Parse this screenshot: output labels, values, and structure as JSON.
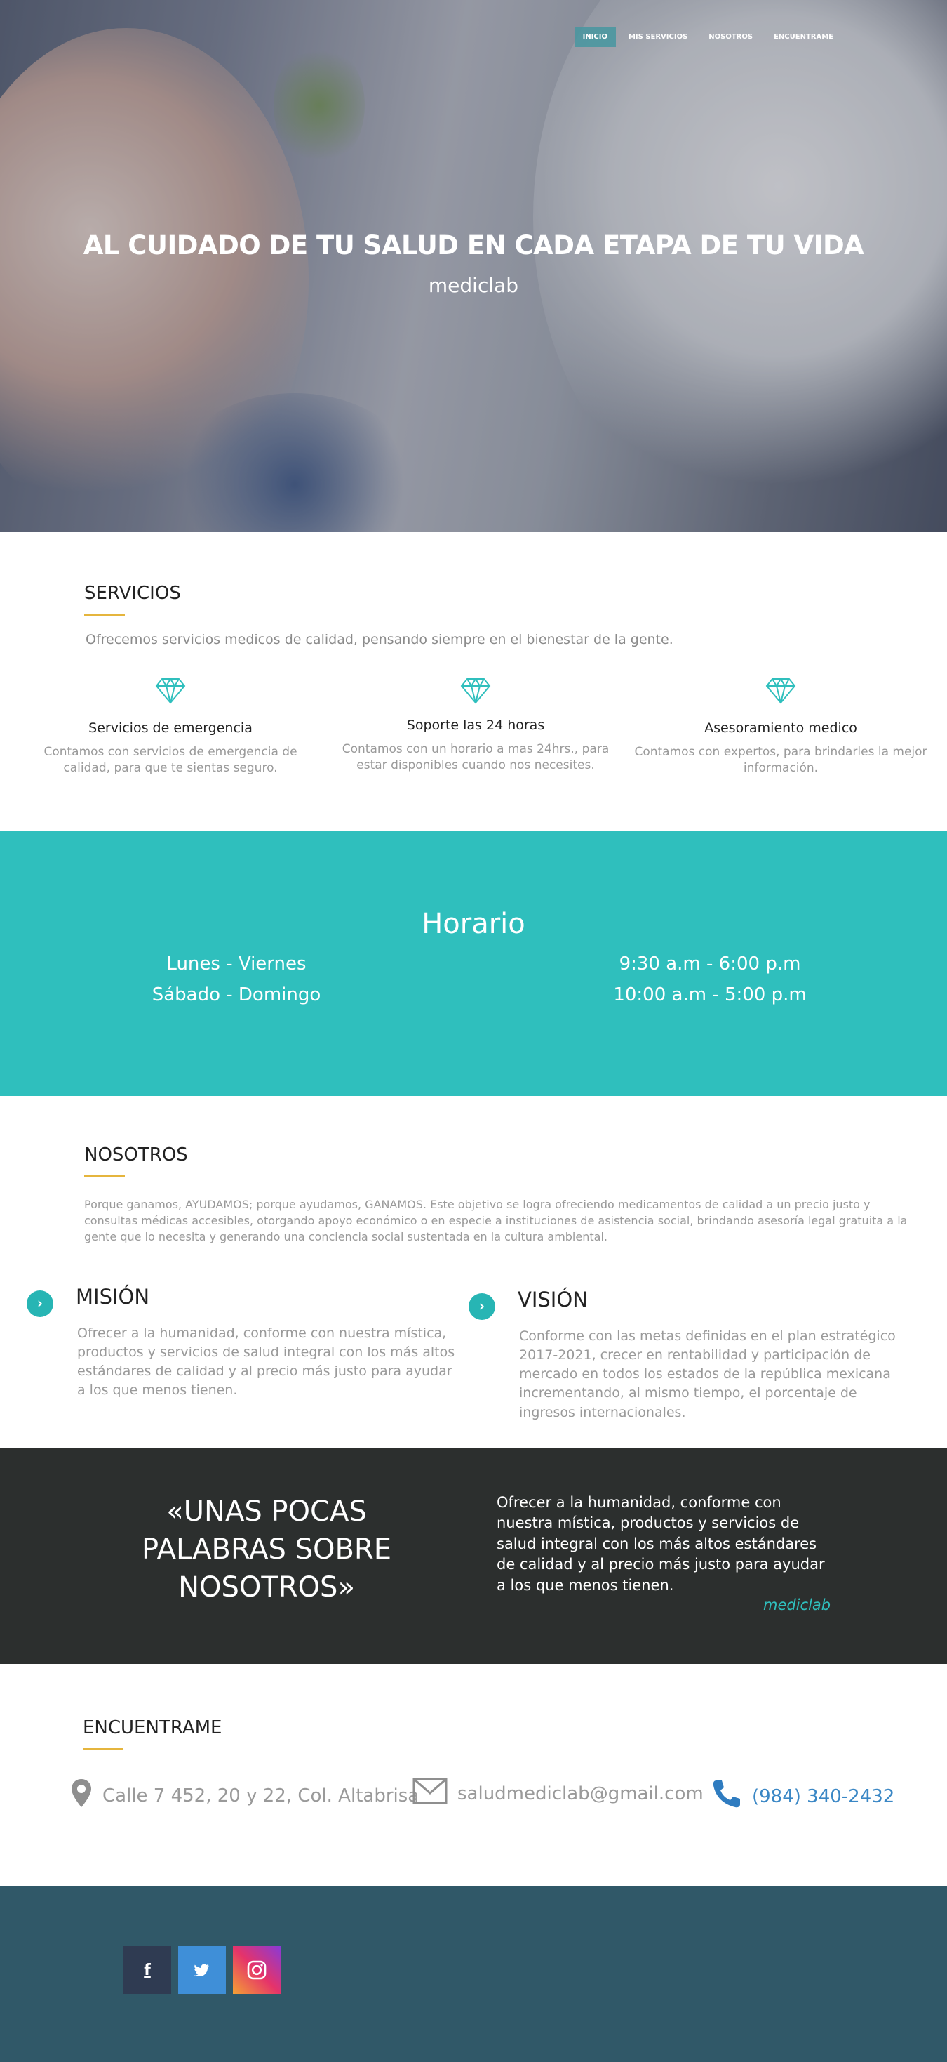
{
  "nav": {
    "items": [
      "INICIO",
      "MIS SERVICIOS",
      "NOSOTROS",
      "ENCUENTRAME"
    ]
  },
  "hero": {
    "title": "AL CUIDADO DE TU SALUD EN CADA ETAPA DE TU VIDA",
    "subtitle": "mediclab"
  },
  "servicios": {
    "title": "SERVICIOS",
    "lead": "Ofrecemos servicios medicos de calidad, pensando siempre en el bienestar de la gente.",
    "items": [
      {
        "icon": "diamond-icon",
        "title": "Servicios de emergencia",
        "text": "Contamos con servicios de emergencia de calidad, para que te sientas seguro."
      },
      {
        "icon": "diamond-icon",
        "title": "Soporte las 24 horas",
        "text": "Contamos con un horario a mas 24hrs., para estar disponibles cuando nos necesites."
      },
      {
        "icon": "diamond-icon",
        "title": "Asesoramiento medico",
        "text": "Contamos con expertos, para brindarles la mejor información."
      }
    ]
  },
  "horario": {
    "title": "Horario",
    "days": [
      "Lunes - Viernes",
      "Sábado - Domingo"
    ],
    "hours": [
      "9:30 a.m - 6:00 p.m",
      "10:00 a.m - 5:00 p.m"
    ]
  },
  "nosotros": {
    "title": "NOSOTROS",
    "text": "Porque ganamos, AYUDAMOS; porque ayudamos, GANAMOS. Este objetivo se logra ofreciendo medicamentos de calidad a un precio justo y consultas médicas accesibles, otorgando apoyo económico o en especie a instituciones de asistencia social, brindando asesoría legal gratuita a la gente que lo necesita y generando una conciencia social sustentada en la cultura ambiental.",
    "mision": {
      "title": "MISIÓN",
      "text": "Ofrecer a la humanidad, conforme con nuestra mística, productos y servicios de salud integral con los más altos estándares de calidad y al precio más justo para ayudar a los que menos tienen."
    },
    "vision": {
      "title": "VISIÓN",
      "text": "Conforme con las metas definidas en el plan estratégico 2017-2021, crecer en rentabilidad y participación de mercado en todos los estados de la república mexicana incrementando, al mismo tiempo, el porcentaje de ingresos internacionales."
    },
    "chevron": "›"
  },
  "quote": {
    "heading": "«UNAS POCAS PALABRAS SOBRE NOSOTROS»",
    "text": "Ofrecer a la humanidad, conforme con nuestra mística, productos y servicios de salud integral con los más altos estándares de calidad y al precio más justo para ayudar a los que menos tienen.",
    "signature": "mediclab"
  },
  "encuentrame": {
    "title": "ENCUENTRAME",
    "address": "Calle 7 452, 20 y 22, Col. Altabrisa",
    "email": "saludmediclab@gmail.com",
    "phone": "(984) 340-2432"
  },
  "footer": {
    "social": [
      {
        "icon": "facebook-icon",
        "label": "f",
        "color": "#2f3b52"
      },
      {
        "icon": "twitter-icon",
        "label": "",
        "color": "#3f8fd8"
      },
      {
        "icon": "instagram-icon",
        "label": "",
        "color": "#d6316c"
      }
    ]
  },
  "colors": {
    "accent": "#2fbfbd",
    "underline": "#e5b53d",
    "quote_bg": "#2c2f2e",
    "footer_bg": "#305868"
  }
}
